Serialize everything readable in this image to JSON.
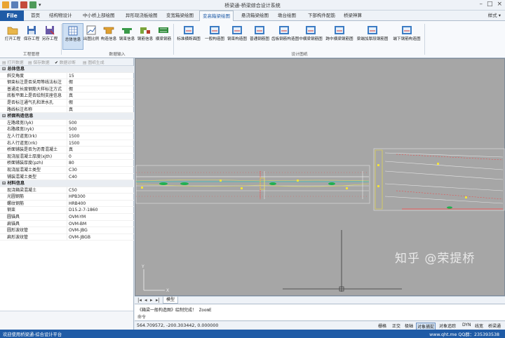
{
  "app": {
    "title": "桥梁通-桥梁综合设计系统",
    "style_label": "样式"
  },
  "tabs": [
    "首页",
    "结构物设计",
    "中小桥上部绘图",
    "异形现浇板绘图",
    "变宽箱梁绘图",
    "变高箱梁绘图",
    "悬浇箱梁绘图",
    "墩台绘图",
    "下部构件配筋",
    "桥梁神算"
  ],
  "file_label": "File",
  "active_tab_index": 5,
  "ribbon": {
    "group1": {
      "label": "工程管理",
      "buttons": [
        "打开工程",
        "保存工程",
        "另存工程"
      ]
    },
    "group2": {
      "label": "数据输入",
      "buttons": [
        "总体信息",
        "出图比例",
        "构造信息",
        "钢束信息",
        "钢筋信息",
        "横梁钢筋"
      ]
    },
    "group3": {
      "label": "设计图纸",
      "buttons": [
        "标准横断面图",
        "一般构造图",
        "钢束构造图",
        "普通钢筋图",
        "齿板钢筋构造图",
        "中横梁钢筋图",
        "跨中横梁钢筋图",
        "梁端加厚段钢筋图",
        "端下钢筋构造图"
      ]
    }
  },
  "left_toolbar": [
    "打开数据",
    "保存数据",
    "数据诊断",
    "图纸生成"
  ],
  "properties": [
    {
      "category": "总体信息",
      "rows": [
        [
          "斜交角度",
          "15"
        ],
        [
          "钢束标注是否采用等线法标注",
          "假"
        ],
        [
          "普通走长度钢筋大样标注方式",
          "假"
        ],
        [
          "底板平面上是否绘制支座信息",
          "真"
        ],
        [
          "是否标注通气孔和泄水孔",
          "假"
        ],
        [
          "路线标注名称",
          "真"
        ]
      ]
    },
    {
      "category": "桥面构造信息",
      "rows": [
        [
          "左路缘宽(lyk)",
          "500"
        ],
        [
          "右路缘宽(ryk)",
          "500"
        ],
        [
          "左人行道宽(lrk)",
          "1500"
        ],
        [
          "右人行道宽(rrk)",
          "1500"
        ],
        [
          "桥面铺装是否为沥青混凝土",
          "真"
        ],
        [
          "现浇层混凝土厚度(xjth)",
          "0"
        ],
        [
          "桥面铺装厚度(pzh)",
          "80"
        ],
        [
          "现浇层混凝土类型",
          "C30"
        ],
        [
          "铺装混凝土类型",
          "C40"
        ]
      ]
    },
    {
      "category": "材料信息",
      "rows": [
        [
          "现浇箱梁混凝土",
          "C50"
        ],
        [
          "光圆钢筋",
          "HPB300"
        ],
        [
          "螺纹钢筋",
          "HRB400"
        ],
        [
          "钢束",
          "D15.2-7-1860"
        ],
        [
          "圆锚具",
          "OVM-YM"
        ],
        [
          "扁锚具",
          "OVM-BM"
        ],
        [
          "圆形波纹管",
          "OVM-JBG"
        ],
        [
          "扁形波纹管",
          "OVM-JBGB"
        ]
      ]
    }
  ],
  "model_tab": "模型",
  "command": {
    "line1": "《箱梁一般构造图》绘制完成！ ZoomE",
    "line2": "命令"
  },
  "coords": "564.709572,  -200.303442,  0.000000",
  "modes": [
    "栅格",
    "正交",
    "极轴",
    "对象捕捉",
    "对象追踪",
    "DYN",
    "线宽",
    "桥梁通"
  ],
  "active_mode_index": 3,
  "status": {
    "left": "欢迎使用桥梁通-综合设计平台",
    "right": "www.qht.me QQ群：235393538"
  },
  "watermark": "知乎 @荣提桥",
  "colors": {
    "accent": "#1f5ba6",
    "canvas_bg": "#a6a6a6"
  }
}
